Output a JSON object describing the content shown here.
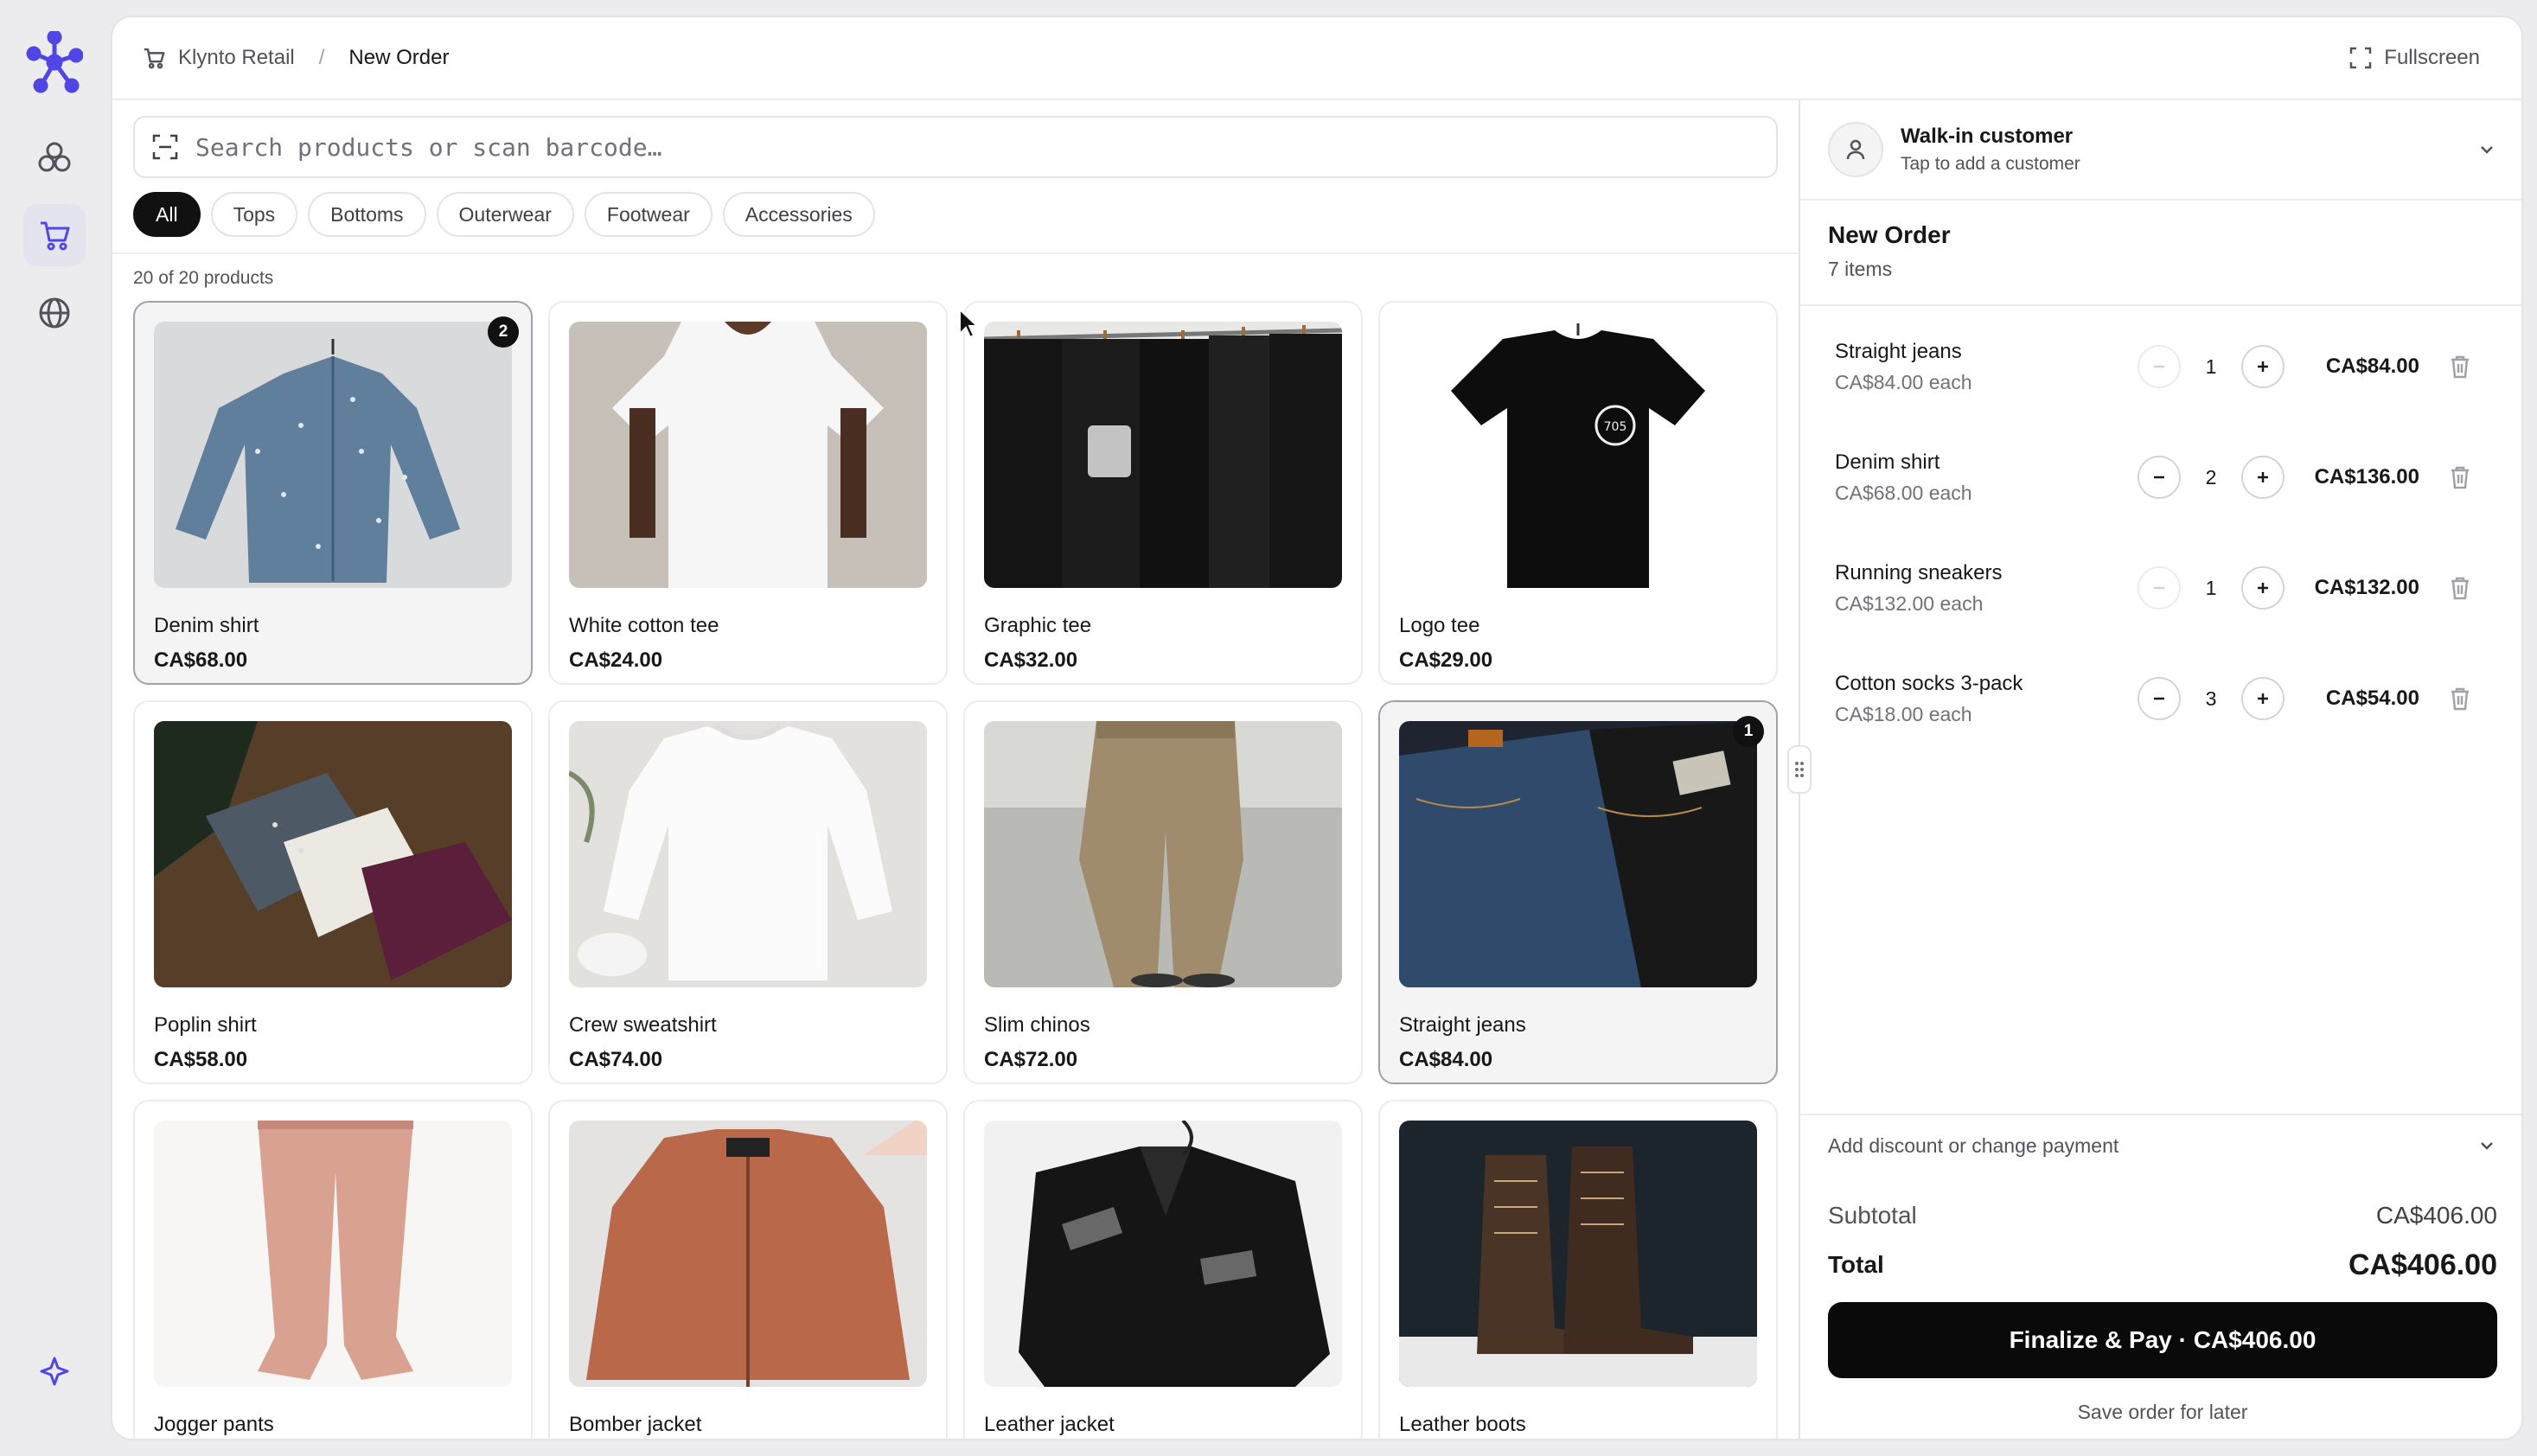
{
  "breadcrumb": {
    "store": "Klynto Retail",
    "separator": "/",
    "current": "New Order"
  },
  "topbar": {
    "fullscreen_label": "Fullscreen"
  },
  "search": {
    "placeholder": "Search products or scan barcode…"
  },
  "filters": [
    {
      "label": "All",
      "active": true
    },
    {
      "label": "Tops",
      "active": false
    },
    {
      "label": "Bottoms",
      "active": false
    },
    {
      "label": "Outerwear",
      "active": false
    },
    {
      "label": "Footwear",
      "active": false
    },
    {
      "label": "Accessories",
      "active": false
    }
  ],
  "product_count": "20 of 20 products",
  "products": [
    {
      "name": "Denim shirt",
      "price": "CA$68.00",
      "badge": "2",
      "selected": true,
      "image": "denim-shirt"
    },
    {
      "name": "White cotton tee",
      "price": "CA$24.00",
      "badge": null,
      "selected": false,
      "image": "white-tee"
    },
    {
      "name": "Graphic tee",
      "price": "CA$32.00",
      "badge": null,
      "selected": false,
      "image": "graphic-tee"
    },
    {
      "name": "Logo tee",
      "price": "CA$29.00",
      "badge": null,
      "selected": false,
      "image": "logo-tee"
    },
    {
      "name": "Poplin shirt",
      "price": "CA$58.00",
      "badge": null,
      "selected": false,
      "image": "poplin-shirt"
    },
    {
      "name": "Crew sweatshirt",
      "price": "CA$74.00",
      "badge": null,
      "selected": false,
      "image": "sweatshirt"
    },
    {
      "name": "Slim chinos",
      "price": "CA$72.00",
      "badge": null,
      "selected": false,
      "image": "chinos"
    },
    {
      "name": "Straight jeans",
      "price": "CA$84.00",
      "badge": "1",
      "selected": true,
      "image": "jeans"
    },
    {
      "name": "Jogger pants",
      "price": "",
      "badge": null,
      "selected": false,
      "image": "joggers"
    },
    {
      "name": "Bomber jacket",
      "price": "",
      "badge": null,
      "selected": false,
      "image": "bomber"
    },
    {
      "name": "Leather jacket",
      "price": "",
      "badge": null,
      "selected": false,
      "image": "leather-jacket"
    },
    {
      "name": "Leather boots",
      "price": "",
      "badge": null,
      "selected": false,
      "image": "boots"
    }
  ],
  "customer": {
    "name": "Walk-in customer",
    "subtitle": "Tap to add a customer"
  },
  "order": {
    "title": "New Order",
    "item_count": "7 items",
    "lines": [
      {
        "name": "Straight jeans",
        "each": "CA$84.00 each",
        "qty": "1",
        "total": "CA$84.00",
        "minus_disabled": true
      },
      {
        "name": "Denim shirt",
        "each": "CA$68.00 each",
        "qty": "2",
        "total": "CA$136.00",
        "minus_disabled": false
      },
      {
        "name": "Running sneakers",
        "each": "CA$132.00 each",
        "qty": "1",
        "total": "CA$132.00",
        "minus_disabled": true
      },
      {
        "name": "Cotton socks 3-pack",
        "each": "CA$18.00 each",
        "qty": "3",
        "total": "CA$54.00",
        "minus_disabled": false
      }
    ],
    "discount_label": "Add discount or change payment",
    "subtotal_label": "Subtotal",
    "subtotal_value": "CA$406.00",
    "total_label": "Total",
    "total_value": "CA$406.00",
    "pay_label": "Finalize & Pay · CA$406.00",
    "save_label": "Save order for later"
  },
  "colors": {
    "accent": "#4f46e5",
    "primary_button": "#0a0a0a",
    "badge": "#111111"
  },
  "icons": {
    "rail": [
      "logo-icon",
      "boxes-icon",
      "cart-icon",
      "globe-icon",
      "sparkle-icon"
    ]
  }
}
